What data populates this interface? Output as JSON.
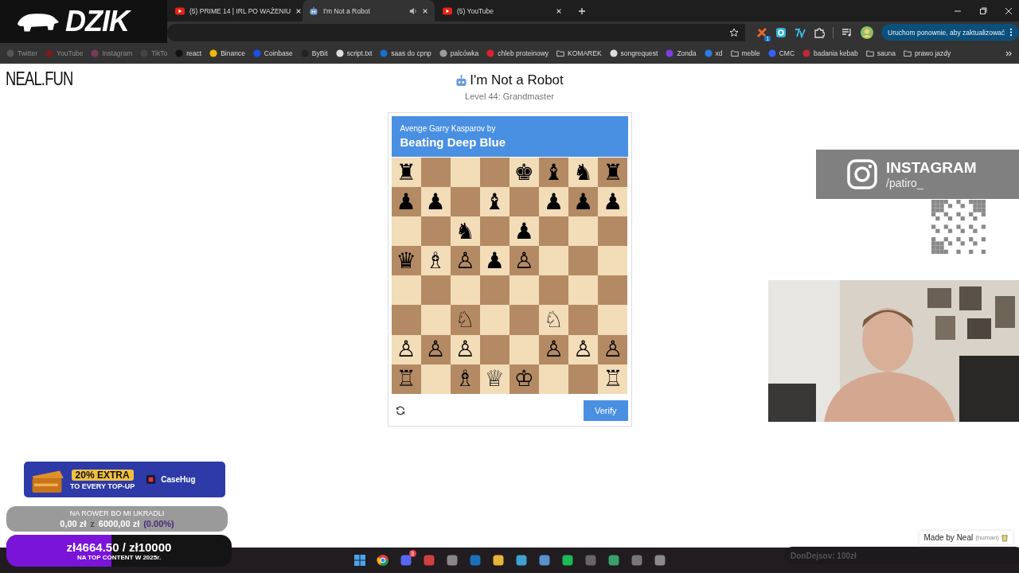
{
  "browser": {
    "tabs": [
      {
        "title": "(5) PRIME 14 | IRL PO WAŻENIU",
        "selected": false,
        "kind": "youtube",
        "audio": false
      },
      {
        "title": "I'm Not a Robot",
        "selected": true,
        "kind": "robot",
        "audio": true
      },
      {
        "title": "(5) YouTube",
        "selected": false,
        "kind": "youtube",
        "audio": false
      }
    ],
    "update_button": "Uruchom ponownie, aby zaktualizować",
    "extension_badge": "1",
    "bookmarks": [
      {
        "label": "Twitter",
        "kind": "site",
        "color": "#555555",
        "dimmed": true
      },
      {
        "label": "YouTube",
        "kind": "site",
        "color": "#7a1a1a",
        "dimmed": true
      },
      {
        "label": "Instagram",
        "kind": "site",
        "color": "#7a3a5a",
        "dimmed": true
      },
      {
        "label": "TikTo",
        "kind": "site",
        "color": "#444444",
        "dimmed": true
      },
      {
        "label": "react",
        "kind": "site",
        "color": "#111111",
        "dimmed": false
      },
      {
        "label": "Binance",
        "kind": "site",
        "color": "#f0b90b",
        "dimmed": false
      },
      {
        "label": "Coinbase",
        "kind": "site",
        "color": "#1652f0",
        "dimmed": false
      },
      {
        "label": "ByBit",
        "kind": "site",
        "color": "#222222",
        "dimmed": false
      },
      {
        "label": "script.txt",
        "kind": "site",
        "color": "#e0e0e0",
        "dimmed": false
      },
      {
        "label": "saas do cpnp",
        "kind": "site",
        "color": "#1a6fd0",
        "dimmed": false
      },
      {
        "label": "palcówka",
        "kind": "site",
        "color": "#9a9a9a",
        "dimmed": false
      },
      {
        "label": "chleb proteinowy",
        "kind": "site",
        "color": "#e02030",
        "dimmed": false
      },
      {
        "label": "KOMAREK",
        "kind": "folder",
        "dimmed": false
      },
      {
        "label": "songrequest",
        "kind": "site",
        "color": "#dddddd",
        "dimmed": false
      },
      {
        "label": "Zonda",
        "kind": "site",
        "color": "#7b3fe4",
        "dimmed": false
      },
      {
        "label": "xd",
        "kind": "site",
        "color": "#2a7de1",
        "dimmed": false
      },
      {
        "label": "meble",
        "kind": "folder",
        "dimmed": false
      },
      {
        "label": "CMC",
        "kind": "site",
        "color": "#3861fb",
        "dimmed": false
      },
      {
        "label": "badania kebab",
        "kind": "site",
        "color": "#c0283a",
        "dimmed": false
      },
      {
        "label": "sauna",
        "kind": "folder",
        "dimmed": false
      },
      {
        "label": "prawo jazdy",
        "kind": "folder",
        "dimmed": false
      }
    ]
  },
  "site_logo": "NEAL.FUN",
  "page": {
    "title": "I'm Not a Robot",
    "subtitle": "Level 44: Grandmaster",
    "card": {
      "prompt": "Avenge Garry Kasparov by",
      "heading": "Beating Deep Blue",
      "verify_button": "Verify",
      "board": [
        [
          {
            "kind": "piece",
            "piece": "♜"
          },
          {
            "kind": "empty"
          },
          {
            "kind": "empty"
          },
          {
            "kind": "empty"
          },
          {
            "kind": "piece",
            "piece": "♚"
          },
          {
            "kind": "piece",
            "piece": "♝"
          },
          {
            "kind": "piece",
            "piece": "♞"
          },
          {
            "kind": "piece",
            "piece": "♜"
          }
        ],
        [
          {
            "kind": "piece",
            "piece": "♟"
          },
          {
            "kind": "piece",
            "piece": "♟"
          },
          {
            "kind": "empty"
          },
          {
            "kind": "piece",
            "piece": "♝"
          },
          {
            "kind": "empty"
          },
          {
            "kind": "piece",
            "piece": "♟"
          },
          {
            "kind": "piece",
            "piece": "♟"
          },
          {
            "kind": "piece",
            "piece": "♟"
          }
        ],
        [
          {
            "kind": "empty"
          },
          {
            "kind": "empty"
          },
          {
            "kind": "piece",
            "piece": "♞"
          },
          {
            "kind": "empty"
          },
          {
            "kind": "piece",
            "piece": "♟"
          },
          {
            "kind": "empty"
          },
          {
            "kind": "empty"
          },
          {
            "kind": "empty"
          }
        ],
        [
          {
            "kind": "piece",
            "piece": "♛"
          },
          {
            "kind": "piece",
            "piece": "♗"
          },
          {
            "kind": "piece",
            "piece": "♙"
          },
          {
            "kind": "piece",
            "piece": "♟"
          },
          {
            "kind": "piece",
            "piece": "♙"
          },
          {
            "kind": "empty"
          },
          {
            "kind": "empty"
          },
          {
            "kind": "empty"
          }
        ],
        [
          {
            "kind": "empty"
          },
          {
            "kind": "empty"
          },
          {
            "kind": "empty"
          },
          {
            "kind": "empty"
          },
          {
            "kind": "empty"
          },
          {
            "kind": "empty"
          },
          {
            "kind": "empty"
          },
          {
            "kind": "empty"
          }
        ],
        [
          {
            "kind": "empty"
          },
          {
            "kind": "empty"
          },
          {
            "kind": "piece",
            "piece": "♘"
          },
          {
            "kind": "empty"
          },
          {
            "kind": "empty"
          },
          {
            "kind": "piece",
            "piece": "♘"
          },
          {
            "kind": "empty"
          },
          {
            "kind": "empty"
          }
        ],
        [
          {
            "kind": "piece",
            "piece": "♙"
          },
          {
            "kind": "piece",
            "piece": "♙"
          },
          {
            "kind": "piece",
            "piece": "♙"
          },
          {
            "kind": "empty"
          },
          {
            "kind": "empty"
          },
          {
            "kind": "piece",
            "piece": "♙"
          },
          {
            "kind": "piece",
            "piece": "♙"
          },
          {
            "kind": "piece",
            "piece": "♙"
          }
        ],
        [
          {
            "kind": "piece",
            "piece": "♖"
          },
          {
            "kind": "empty"
          },
          {
            "kind": "piece",
            "piece": "♗"
          },
          {
            "kind": "piece",
            "piece": "♕"
          },
          {
            "kind": "piece",
            "piece": "♔"
          },
          {
            "kind": "empty"
          },
          {
            "kind": "empty"
          },
          {
            "kind": "piece",
            "piece": "♖"
          }
        ]
      ]
    },
    "footer": {
      "credit": "Made by Neal",
      "credit_note": "(human)"
    }
  },
  "overlays": {
    "brand": "DZIK",
    "instagram": {
      "title": "INSTAGRAM",
      "handle": "/patiro_"
    },
    "ad": {
      "headline": "20% EXTRA",
      "subline": "TO EVERY TOP-UP",
      "brand": "CaseHug"
    },
    "donation": {
      "title": "NA ROWER BO MI UKRADLI",
      "raised": "0,00 zł",
      "separator": "z",
      "target": "6000,00 zł",
      "percent": "(0.00%)"
    },
    "goal": {
      "amount": "zł4664.50 / zł10000",
      "caption": "NA TOP CONTENT W 2025r.",
      "level": 0.4665
    },
    "alert": "DonDejsov: 100zł"
  },
  "taskbar": {
    "discord_badge": "3"
  }
}
